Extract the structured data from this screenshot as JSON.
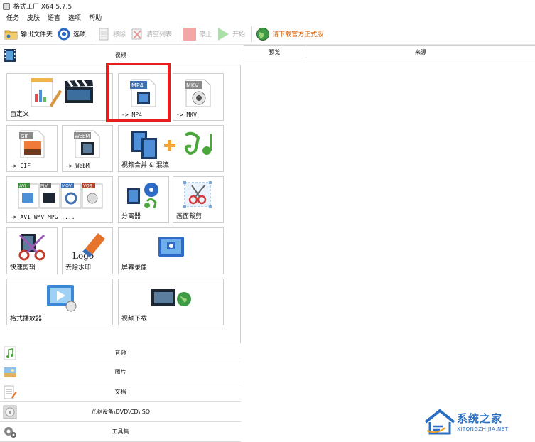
{
  "window": {
    "title": "格式工厂 X64 5.7.5"
  },
  "menu": [
    "任务",
    "皮肤",
    "语言",
    "选项",
    "帮助"
  ],
  "toolbar": {
    "output_folder": "输出文件夹",
    "options": "选项",
    "remove": "移除",
    "clear_list": "清空列表",
    "stop": "停止",
    "start": "开始",
    "download_notice": "请下载官方正式版"
  },
  "categories": {
    "video": "视频",
    "audio": "音频",
    "image": "图片",
    "document": "文档",
    "disc": "光驱设备\\DVD\\CD\\ISO",
    "tools": "工具集"
  },
  "video_tiles": {
    "custom": "自定义",
    "mp4": "-> MP4",
    "mkv": "-> MKV",
    "gif": "-> GIF",
    "webm": "-> WebM",
    "merge": "视频合并 & 混流",
    "avi_wmv": "-> AVI WMV MPG ....",
    "splitter": "分离器",
    "crop": "画面裁剪",
    "quick_cut": "快速剪辑",
    "remove_watermark": "去除水印",
    "screen_record": "屏幕录像",
    "player": "格式播放器",
    "download": "视频下载"
  },
  "tile_badges": {
    "mp4": "MP4",
    "mkv": "MKV",
    "gif": "GIF",
    "webm": "WebM",
    "avi": "AVI",
    "flv": "FLV",
    "mov": "MOV",
    "vob": "VOB",
    "logo": "Logo"
  },
  "table": {
    "preview": "预览",
    "source": "来源"
  },
  "watermark": {
    "main": "系统之家",
    "sub": "XITONGZHIJIA.NET"
  },
  "colors": {
    "highlight": "#e81e1e",
    "accent": "#2b6fc2",
    "notice": "#d45a00"
  }
}
